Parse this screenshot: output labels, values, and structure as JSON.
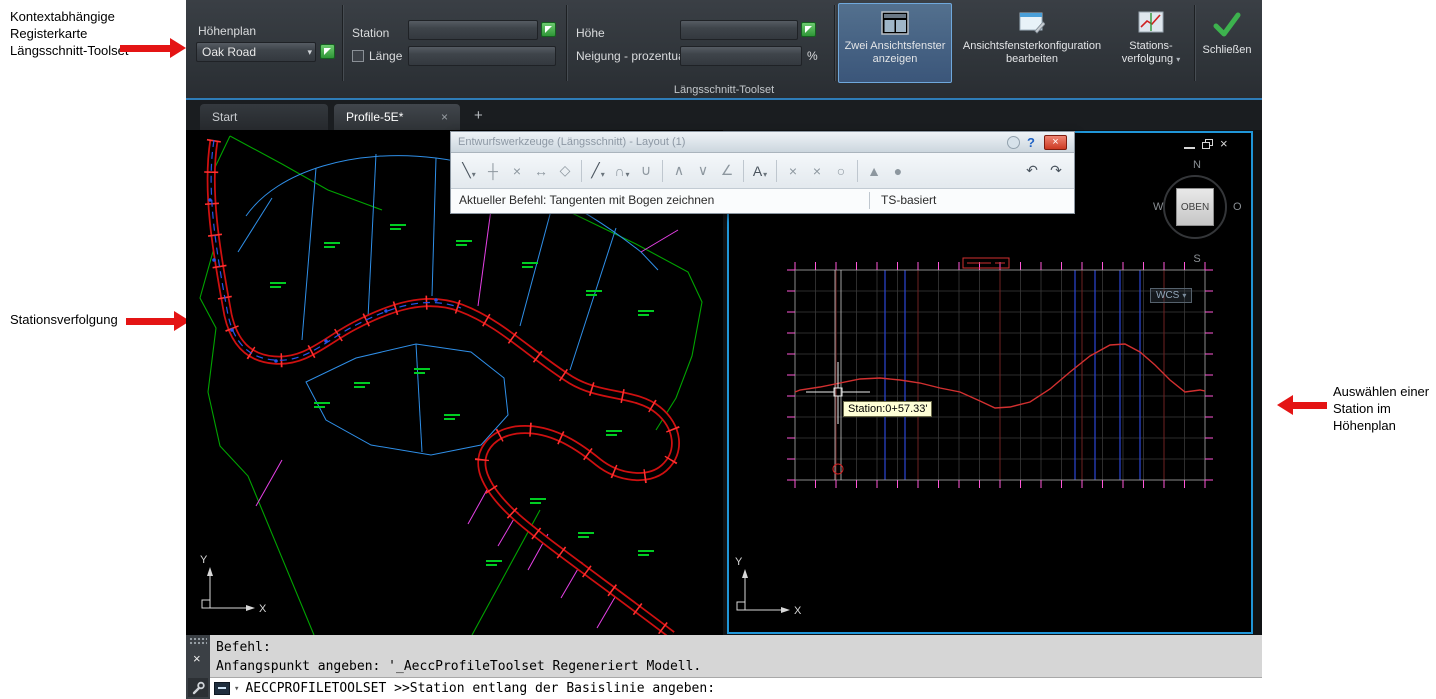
{
  "glyphs": {
    "caret": "▾",
    "close": "×",
    "plus": "+",
    "help": "?"
  },
  "annotations": {
    "context_tab": "Kontextabhängige Registerkarte Längsschnitt-Toolset",
    "station_tracking": "Stationsverfolgung",
    "select_station": "Auswählen einer Station im Höhenplan"
  },
  "ribbon": {
    "profile_label": "Höhenplan",
    "profile_value": "Oak Road",
    "station_label": "Station",
    "length_label": "Länge",
    "elevation_label": "Höhe",
    "grade_label": "Neigung - prozentual",
    "percent_sign": "%",
    "buttons": {
      "two_viewports": {
        "line1": "Zwei Ansichtsfenster",
        "line2": "anzeigen"
      },
      "config": {
        "line1": "Ansichtsfensterkonfiguration",
        "line2": "bearbeiten"
      },
      "tracking": {
        "line1": "Stations-",
        "line2": "verfolgung"
      },
      "close": "Schließen"
    },
    "panel_label": "Längsschnitt-Toolset"
  },
  "tabbar": {
    "tabs": [
      {
        "label": "Start"
      },
      {
        "label": "Profile-5E*"
      }
    ]
  },
  "toolbar": {
    "title": "Entwurfswerkzeuge (Längsschnitt) - Layout (1)",
    "status_command": "Aktueller Befehl: Tangenten mit Bogen zeichnen",
    "status_mode": "TS-basiert",
    "icons": [
      {
        "name": "draw-tangents-icon",
        "glyph": "╲"
      },
      {
        "name": "insert-pvi-icon",
        "glyph": "┼"
      },
      {
        "name": "delete-pvi-icon",
        "glyph": "×"
      },
      {
        "name": "move-pvi-icon",
        "glyph": "↔"
      },
      {
        "name": "convert-entity-icon",
        "glyph": "◇"
      },
      {
        "name": "draw-fixed-tangent-icon",
        "glyph": "╱"
      },
      {
        "name": "draw-curve-icon",
        "glyph": "∩"
      },
      {
        "name": "free-curve-icon",
        "glyph": "∪"
      },
      {
        "name": "crest-curve-icon",
        "glyph": "∧"
      },
      {
        "name": "sag-curve-icon",
        "glyph": "∨"
      },
      {
        "name": "grade-tool-icon",
        "glyph": "∠"
      },
      {
        "name": "label-tool-icon",
        "glyph": "A"
      },
      {
        "name": "delete-entity-icon",
        "glyph": "×"
      },
      {
        "name": "delete-subentity-icon",
        "glyph": "×"
      },
      {
        "name": "erase-tool-icon",
        "glyph": "○"
      },
      {
        "name": "raise-lower-icon",
        "glyph": "▲"
      },
      {
        "name": "select-pvi-icon",
        "glyph": "●"
      },
      {
        "name": "undo-icon",
        "glyph": "↶"
      },
      {
        "name": "redo-icon",
        "glyph": "↷"
      }
    ]
  },
  "plan_view": {
    "axis_x": "X",
    "axis_y": "Y"
  },
  "profile_view": {
    "axis_x": "X",
    "axis_y": "Y",
    "tooltip": "Station:0+57.33'",
    "wcs_label": "WCS",
    "viewcube": {
      "top": "OBEN",
      "north": "N",
      "south": "S",
      "west": "W",
      "east": "O"
    }
  },
  "command_line": {
    "line1": "Befehl:",
    "line2": "Anfangspunkt angeben: '_AeccProfileToolset Regeneriert Modell.",
    "prompt": "AECCPROFILETOOLSET >>Station entlang der Basislinie angeben:"
  },
  "colors": {
    "accent_blue": "#2096d8",
    "selection_blue": "#6fa8dc",
    "annotation_red": "#e41414",
    "boundary_green": "#00a400",
    "parcel_cyan": "#2f8fe8",
    "parcel_magenta": "#e640e6",
    "alignment_red": "#cf1010",
    "profile_red": "#d23030"
  }
}
